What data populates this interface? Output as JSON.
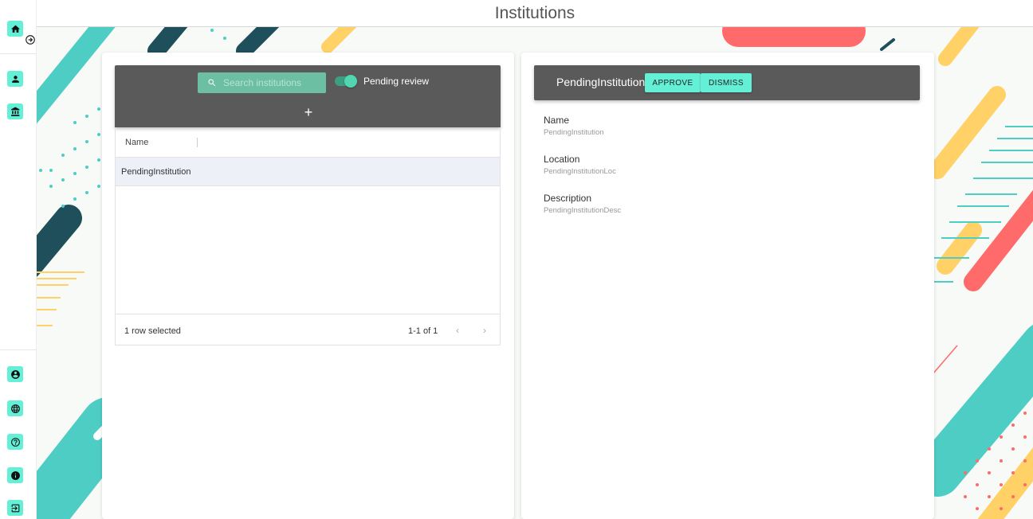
{
  "header": {
    "title": "Institutions"
  },
  "sidebar": {
    "top": [
      {
        "icon": "home-icon"
      }
    ],
    "middle": [
      {
        "icon": "user-icon"
      },
      {
        "icon": "institution-icon"
      }
    ],
    "bottom": [
      {
        "icon": "account-circle-icon"
      },
      {
        "icon": "globe-icon"
      },
      {
        "icon": "help-icon"
      },
      {
        "icon": "info-icon"
      },
      {
        "icon": "logout-icon"
      }
    ]
  },
  "list": {
    "search_placeholder": "Search institutions",
    "pending_toggle_label": "Pending review",
    "pending_toggle_on": true,
    "add_label": "+",
    "columns": [
      "Name"
    ],
    "rows": [
      {
        "name": "PendingInstitution",
        "selected": true
      }
    ],
    "footer": {
      "selected_text": "1 row selected",
      "pagination": "1-1 of 1",
      "prev": "‹",
      "next": "›"
    }
  },
  "detail": {
    "title": "PendingInstitution",
    "approve_label": "APPROVE",
    "dismiss_label": "DISMISS",
    "fields": [
      {
        "label": "Name",
        "value": "PendingInstitution"
      },
      {
        "label": "Location",
        "value": "PendingInstitutionLoc"
      },
      {
        "label": "Description",
        "value": "PendingInstitutionDesc"
      }
    ]
  },
  "colors": {
    "accent": "#64f0d6",
    "toolbar": "#5a5a5a",
    "search": "#6dbfa3",
    "teal": "#4ecdc4",
    "coral": "#ff6b6b",
    "yellow": "#ffd166",
    "dark": "#1e4f5a"
  }
}
